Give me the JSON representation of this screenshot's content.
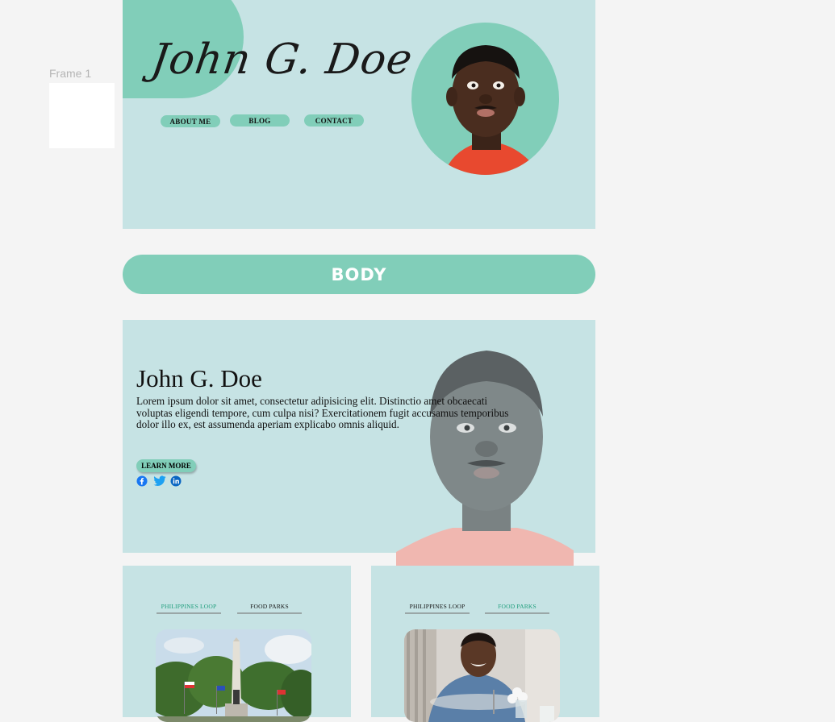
{
  "canvas": {
    "frame_label": "Frame 1"
  },
  "header": {
    "logo": "John G. Doe",
    "nav": [
      {
        "label": "ABOUT ME"
      },
      {
        "label": "BLOG"
      },
      {
        "label": "CONTACT"
      }
    ]
  },
  "body_banner": {
    "label": "BODY"
  },
  "hero": {
    "name": "John G. Doe",
    "text": "Lorem ipsum dolor sit amet, consectetur adipisicing elit. Distinctio amet obcaecati voluptas eligendi tempore, cum culpa nisi? Exercitationem fugit accusamus temporibus dolor illo ex, est assumenda aperiam explicabo omnis aliquid.",
    "cta": "LEARN MORE",
    "social": [
      "facebook-icon",
      "twitter-icon",
      "linkedin-icon"
    ]
  },
  "cards": [
    {
      "tabs": [
        {
          "label": "PHILIPPINES LOOP",
          "active": true
        },
        {
          "label": "FOOD PARKS",
          "active": false
        }
      ]
    },
    {
      "tabs": [
        {
          "label": "PHILIPPINES LOOP",
          "active": false
        },
        {
          "label": "FOOD PARKS",
          "active": true
        }
      ]
    }
  ],
  "colors": {
    "panel": "#c6e3e4",
    "accent": "#81ceb9",
    "background": "#f4f4f4",
    "active_tab": "#1f9e7c"
  }
}
